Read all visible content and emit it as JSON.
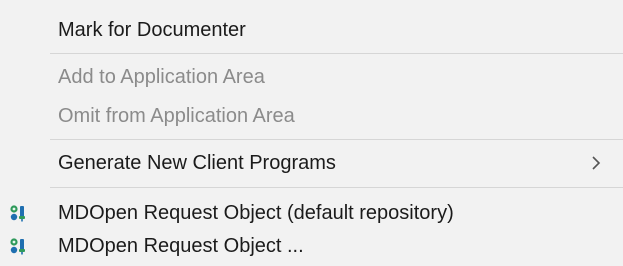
{
  "menu": {
    "items": [
      {
        "label": "Mark for Documenter",
        "enabled": true
      },
      {
        "label": "Add to Application Area",
        "enabled": false
      },
      {
        "label": "Omit from Application Area",
        "enabled": false
      },
      {
        "label": "Generate New Client Programs",
        "enabled": true,
        "has_submenu": true
      },
      {
        "label": "MDOpen Request Object (default repository)",
        "enabled": true,
        "icon": "request-object-icon"
      },
      {
        "label": "MDOpen Request Object ...",
        "enabled": true,
        "icon": "request-object-icon"
      }
    ]
  },
  "colors": {
    "background": "#f2f2f2",
    "text": "#1b1b1b",
    "disabled_text": "#8b8b8b",
    "separator": "#d6d6d6",
    "icon_blue": "#1f6fb0",
    "icon_green": "#2f9a5b"
  }
}
